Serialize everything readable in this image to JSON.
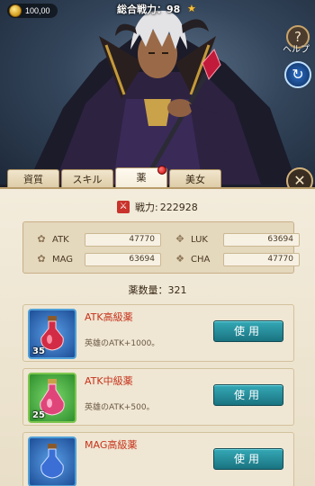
{
  "header": {
    "currency_value": "100,00",
    "title": "総合戦力：98",
    "help_label": "ヘルプ",
    "help_symbol": "?"
  },
  "tabs": [
    {
      "label": "資質",
      "active": false
    },
    {
      "label": "スキル",
      "active": false
    },
    {
      "label": "薬",
      "active": true
    },
    {
      "label": "美女",
      "active": false
    }
  ],
  "power": {
    "label": "戦力:",
    "value": "222928"
  },
  "stats": [
    {
      "label": "ATK",
      "value": "47770",
      "icon": "atk-icon"
    },
    {
      "label": "LUK",
      "value": "63694",
      "icon": "luk-icon"
    },
    {
      "label": "MAG",
      "value": "63694",
      "icon": "mag-icon"
    },
    {
      "label": "CHA",
      "value": "47770",
      "icon": "cha-icon"
    }
  ],
  "potion_count": {
    "label": "薬数量：321"
  },
  "items": [
    {
      "name": "ATK高級薬",
      "desc": "英雄のATK+1000。",
      "qty": "35",
      "button": "使用",
      "frame": "blue"
    },
    {
      "name": "ATK中級薬",
      "desc": "英雄のATK+500。",
      "qty": "25",
      "button": "使用",
      "frame": "green"
    },
    {
      "name": "MAG高級薬",
      "desc": "",
      "qty": "",
      "button": "使用",
      "frame": "blue"
    }
  ],
  "colors": {
    "accent_teal": "#1a7380",
    "item_name_red": "#c6331b",
    "panel_bg": "#f3ecdc"
  }
}
